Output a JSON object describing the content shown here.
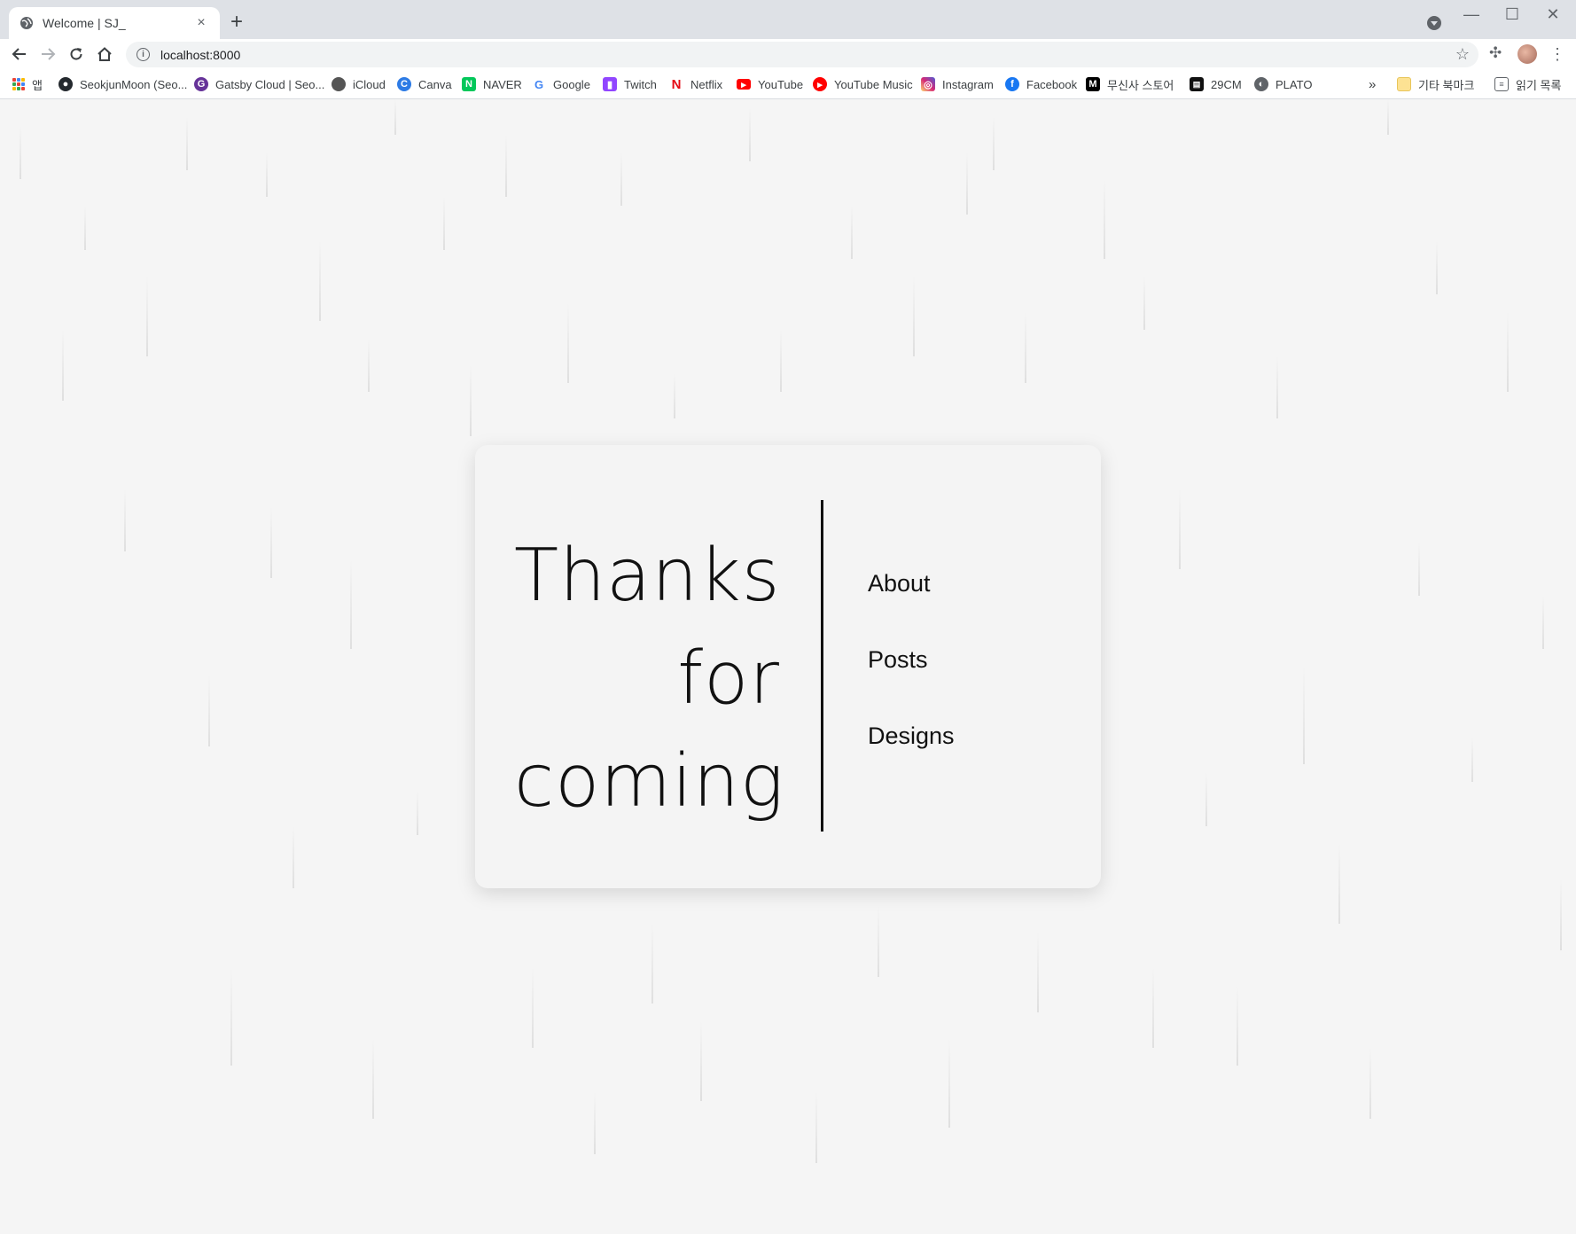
{
  "browser": {
    "tab_title": "Welcome | SJ_",
    "tab_close": "×",
    "new_tab": "+",
    "url": "localhost:8000",
    "window_controls": [
      "—",
      "☐",
      "✕"
    ]
  },
  "bookmarks": {
    "apps_label": "앱",
    "items": [
      {
        "label": "SeokjunMoon (Seo...",
        "icon": "github-icon",
        "color": "#24292e"
      },
      {
        "label": "Gatsby Cloud | Seo...",
        "icon": "gatsby-icon",
        "color": "#663399"
      },
      {
        "label": "iCloud",
        "icon": "apple-icon",
        "color": "#555555"
      },
      {
        "label": "Canva",
        "icon": "canva-icon",
        "color": "#2d7be5"
      },
      {
        "label": "NAVER",
        "icon": "naver-icon",
        "color": "#03c75a"
      },
      {
        "label": "Google",
        "icon": "google-icon",
        "color": "#4285f4"
      },
      {
        "label": "Twitch",
        "icon": "twitch-icon",
        "color": "#9146ff"
      },
      {
        "label": "Netflix",
        "icon": "netflix-icon",
        "color": "#e50914"
      },
      {
        "label": "YouTube",
        "icon": "youtube-icon",
        "color": "#ff0000"
      },
      {
        "label": "YouTube Music",
        "icon": "youtube-music-icon",
        "color": "#ff0000"
      },
      {
        "label": "Instagram",
        "icon": "instagram-icon",
        "color": "#d62976"
      },
      {
        "label": "Facebook",
        "icon": "facebook-icon",
        "color": "#1877f2"
      },
      {
        "label": "무신사 스토어",
        "icon": "musinsa-icon",
        "color": "#000000"
      },
      {
        "label": "29CM",
        "icon": "29cm-icon",
        "color": "#111111"
      },
      {
        "label": "PLATO",
        "icon": "globe-icon",
        "color": "#5f6368"
      }
    ],
    "overflow": "»",
    "other_bookmarks": "기타 북마크",
    "reading_list": "읽기 목록"
  },
  "hero": {
    "line1": "Thanks",
    "line2": "for",
    "line3": "coming"
  },
  "menu": {
    "about": "About",
    "posts": "Posts",
    "designs": "Designs"
  }
}
